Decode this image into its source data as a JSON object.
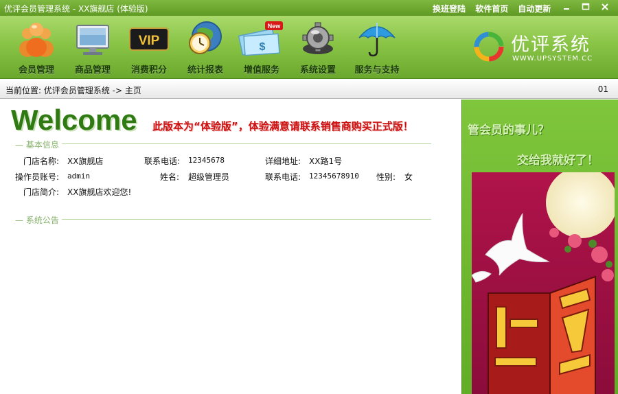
{
  "window": {
    "title": "优评会员管理系统 - XX旗舰店 (体验版)",
    "links": [
      "换班登陆",
      "软件首页",
      "自动更新"
    ]
  },
  "toolbar": {
    "items": [
      {
        "label": "会员管理",
        "icon": "members-icon"
      },
      {
        "label": "商品管理",
        "icon": "monitor-icon"
      },
      {
        "label": "消费积分",
        "icon": "vip-icon",
        "badge": "VIP"
      },
      {
        "label": "统计报表",
        "icon": "clock-globe-icon"
      },
      {
        "label": "增值服务",
        "icon": "money-icon",
        "badge": "New"
      },
      {
        "label": "系统设置",
        "icon": "gear-icon"
      },
      {
        "label": "服务与支持",
        "icon": "umbrella-icon"
      }
    ],
    "brand": {
      "name": "优评系统",
      "url": "WWW.UPSYSTEM.CC"
    }
  },
  "breadcrumb": {
    "text": "当前位置: 优评会员管理系统 -> 主页",
    "code": "01"
  },
  "main": {
    "welcome": "Welcome",
    "notice": "此版本为“体验版”，体验满意请联系销售商购买正式版！",
    "basic_info": {
      "title": "基本信息",
      "store_name_label": "门店名称:",
      "store_name": "XX旗舰店",
      "phone_label": "联系电话:",
      "phone": "12345678",
      "address_label": "详细地址:",
      "address": "XX路1号",
      "operator_label": "操作员账号:",
      "operator": "admin",
      "name_label": "姓名:",
      "name": "超级管理员",
      "contact_label": "联系电话:",
      "contact": "12345678910",
      "gender_label": "性别:",
      "gender": "女",
      "intro_label": "门店简介:",
      "intro": "XX旗舰店欢迎您!"
    },
    "announcement": {
      "title": "系统公告"
    }
  },
  "side": {
    "slogan_1": "管会员的事儿？",
    "slogan_2": "交给我就好了！"
  },
  "colors": {
    "primary_green": "#6aa82d",
    "notice_red": "#cc1111",
    "welcome_green": "#2f7a12"
  }
}
